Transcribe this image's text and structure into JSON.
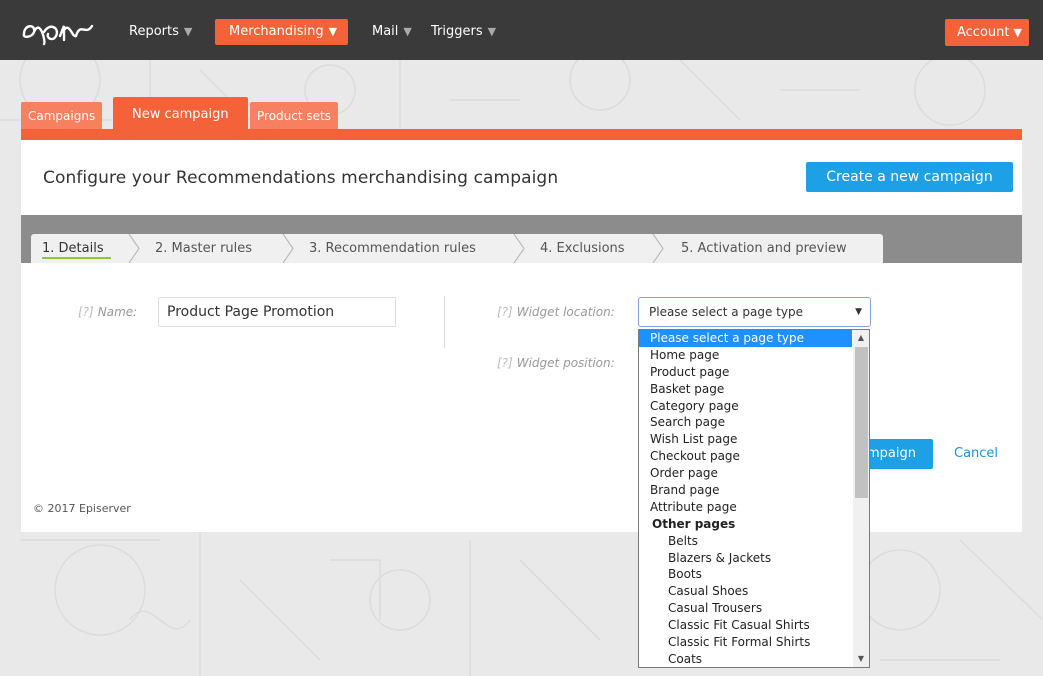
{
  "nav": {
    "reports": "Reports",
    "merchandising": "Merchandising",
    "mail": "Mail",
    "triggers": "Triggers",
    "account": "Account",
    "caret": "▼"
  },
  "tabs": {
    "campaigns": "Campaigns",
    "new_campaign": "New campaign",
    "product_sets": "Product sets"
  },
  "header": {
    "title": "Configure your Recommendations merchandising campaign",
    "create_button": "Create a new campaign"
  },
  "steps": [
    "1. Details",
    "2. Master rules",
    "3. Recommendation rules",
    "4. Exclusions",
    "5. Activation and preview"
  ],
  "form": {
    "help": "[?]",
    "name_label": "Name:",
    "name_value": "Product Page Promotion",
    "widget_location_label": "Widget location:",
    "widget_position_label": "Widget position:",
    "widget_location_value": "Please select a page type",
    "select_arrow": "▼"
  },
  "actions": {
    "save_partial": "mpaign",
    "cancel": "Cancel"
  },
  "footer": {
    "copyright": "© 2017 Episerver"
  },
  "dropdown": {
    "selected": "Please select a page type",
    "items": [
      "Home page",
      "Product page",
      "Basket page",
      "Category page",
      "Search page",
      "Wish List page",
      "Checkout page",
      "Order page",
      "Brand page",
      "Attribute page"
    ],
    "group_label": "Other pages",
    "sub_items": [
      "Belts",
      "Blazers & Jackets",
      "Boots",
      "Casual Shoes",
      "Casual Trousers",
      "Classic Fit Casual Shirts",
      "Classic Fit Formal Shirts",
      "Coats"
    ],
    "scroll_up": "▲",
    "scroll_down": "▼"
  },
  "colors": {
    "accent_orange": "#f4623a",
    "tab_orange": "#f6805f",
    "primary_blue": "#1ea0e6",
    "topbar": "#3a3a3a",
    "step_bar": "#8c8c8c",
    "active_step_underline": "#8dc63f"
  }
}
